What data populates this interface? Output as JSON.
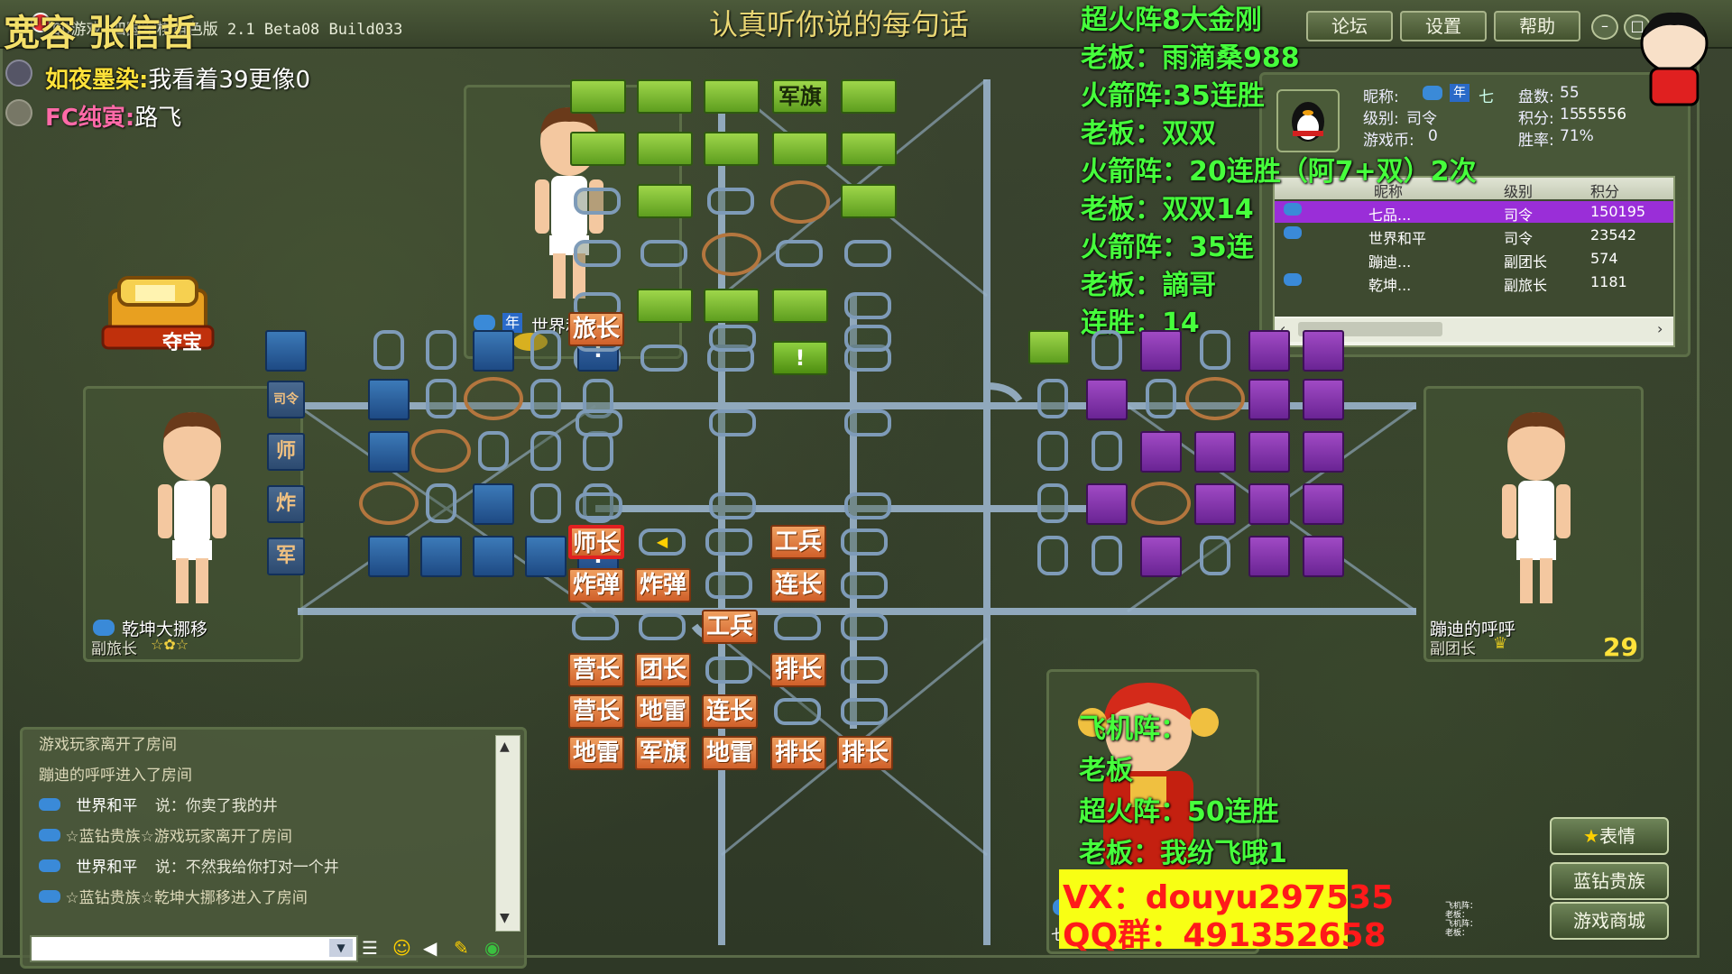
{
  "window": {
    "title": "QQ游戏 四国军棋角色版 2.1 Beta08 Build033",
    "buttons": [
      "论坛",
      "设置",
      "帮助"
    ]
  },
  "stream_overlay": {
    "top_left_names": "宽容 张信哲",
    "center_top_text": "认真听你说的每句话",
    "danmaku": [
      {
        "user": "如夜墨染:",
        "text": "我看着39更像0"
      },
      {
        "user": "FC纯寅:",
        "text": "路飞"
      }
    ],
    "right_list": [
      "超火阵8大金刚",
      "老板：雨滴桑988",
      "火箭阵:35连胜",
      "老板：双双",
      "火箭阵：20连胜（阿7+双）2次",
      "老板：双双14",
      "火箭阵：35连",
      "老板：謫哥",
      "连胜：14"
    ],
    "bottom_overlay": [
      "飞机阵：",
      "老板",
      "超火阵：50连胜",
      "老板：我纷飞哦1"
    ],
    "contact_vx": "VX：douyu297535",
    "contact_qq": "QQ群：491352658",
    "corner_tiny": [
      "飞机阵：",
      "老板：",
      "飞机阵：",
      "老板："
    ]
  },
  "profile": {
    "nick_label": "昵称:",
    "nick_value": "七",
    "rank_label": "级别:",
    "rank_value": "司令",
    "coins_label": "游戏币:",
    "coins_value": "0",
    "games_label": "盘数:",
    "games_value": "55",
    "score_label": "积分:",
    "score_value": "15",
    "score_suffix": "55556",
    "winrate_label": "胜率:",
    "winrate_value": "71%"
  },
  "player_table": {
    "headers": [
      "昵称",
      "级别",
      "积分"
    ],
    "rows": [
      {
        "name": "七品...",
        "rank": "司令",
        "score": "150195",
        "selected": true
      },
      {
        "name": "世界和平",
        "rank": "司令",
        "score": "23542",
        "selected": false
      },
      {
        "name": "蹦迪...",
        "rank": "副团长",
        "score": "574",
        "selected": false
      },
      {
        "name": "乾坤...",
        "rank": "副旅长",
        "score": "1181",
        "selected": false
      }
    ]
  },
  "players": {
    "top": {
      "name": "世界和平",
      "rank": "司令",
      "badge": "年"
    },
    "left": {
      "name": "乾坤大挪移",
      "rank": "副旅长"
    },
    "right": {
      "name": "蹦迪的呼呼",
      "rank": "副团长",
      "timer": "29"
    },
    "bottom": {
      "name": "七"
    }
  },
  "treasure": {
    "label": "夺宝"
  },
  "board": {
    "top_flag": "军旗",
    "left_pieces": [
      "司令",
      "师",
      "炸",
      "军"
    ],
    "orange_pieces": [
      {
        "t": "旅长"
      },
      {
        "t": "师长"
      },
      {
        "t": "工兵"
      },
      {
        "t": "炸弹"
      },
      {
        "t": "炸弹"
      },
      {
        "t": "连长"
      },
      {
        "t": "工兵"
      },
      {
        "t": "营长"
      },
      {
        "t": "团长"
      },
      {
        "t": "排长"
      },
      {
        "t": "营长"
      },
      {
        "t": "地雷"
      },
      {
        "t": "连长"
      },
      {
        "t": "地雷"
      },
      {
        "t": "军旗"
      },
      {
        "t": "地雷"
      },
      {
        "t": "排长"
      },
      {
        "t": "排长"
      }
    ],
    "mark": "!"
  },
  "chat": {
    "lines": [
      {
        "text": "游戏玩家离开了房间"
      },
      {
        "text": "蹦迪的呼呼进入了房间"
      },
      {
        "name": "世界和平",
        "text": "说：你卖了我的井"
      },
      {
        "text": "☆蓝钻贵族☆游戏玩家离开了房间"
      },
      {
        "name": "世界和平",
        "text": "说：不然我给你打对一个井"
      },
      {
        "text": "☆蓝钻贵族☆乾坤大挪移进入了房间"
      }
    ],
    "input_placeholder": ""
  },
  "side_buttons": [
    "表情",
    "蓝钻贵族",
    "游戏商城"
  ],
  "colors": {
    "green": "#7fc23a",
    "blue": "#2a5e9e",
    "purple": "#8a3ab0",
    "orange": "#e07a3c",
    "overlay_yellow": "#ffe23a",
    "overlay_green": "#46ff3c"
  }
}
